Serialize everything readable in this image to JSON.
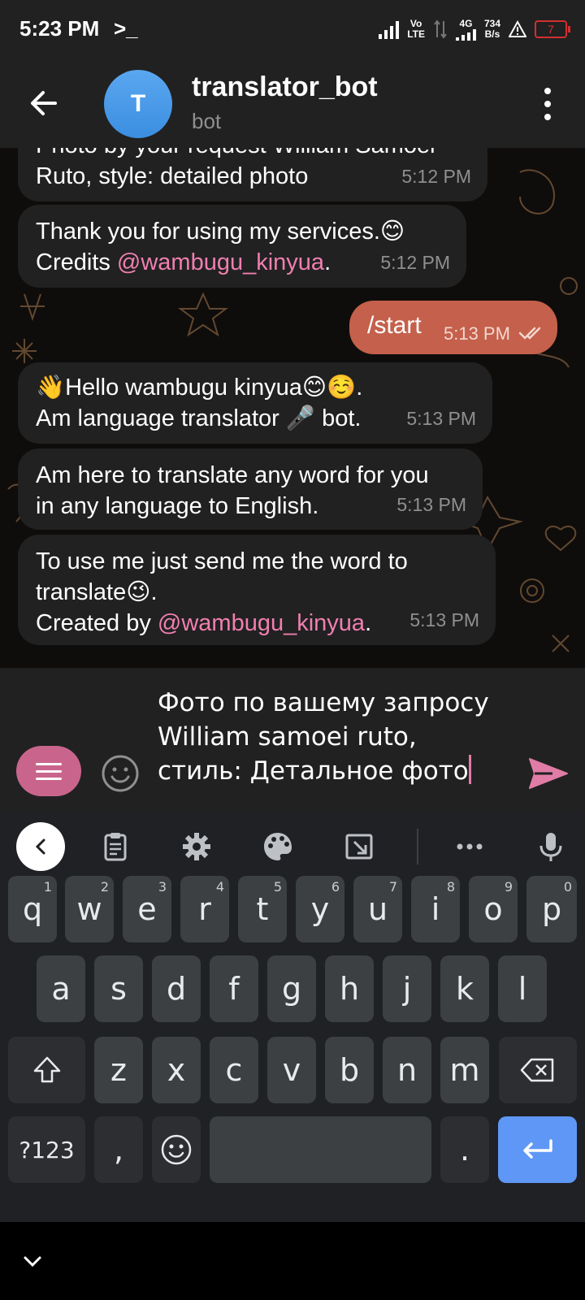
{
  "status": {
    "time": "5:23 PM",
    "prompt_icon": "terminal-prompt-icon",
    "network_label_top": "Vo",
    "network_label_bottom": "LTE",
    "data_gen": "4G",
    "speed_value": "734",
    "speed_unit": "B/s",
    "battery": "7"
  },
  "header": {
    "avatar_letter": "T",
    "title": "translator_bot",
    "subtitle": "bot"
  },
  "messages": [
    {
      "text": "Photo by your request William Samoei\nRuto, style: detailed photo",
      "time": "5:12 PM"
    },
    {
      "text_before": "Thank you for using my services.😊\nCredits ",
      "mention": "@wambugu_kinyua",
      "text_after": ".",
      "time": "5:12 PM"
    },
    {
      "text": "/start",
      "time": "5:13 PM",
      "outgoing": true
    },
    {
      "text": "👋Hello wambugu kinyua😊☺️.\n Am language translator 🎤 bot.",
      "time": "5:13 PM"
    },
    {
      "text": "Am here to translate any word for you\nin any language to English.",
      "time": "5:13 PM"
    },
    {
      "text_before": "To use me just send me the word to\ntranslate😉.\nCreated by  ",
      "mention": "@wambugu_kinyua",
      "text_after": ".",
      "time": "5:13 PM"
    }
  ],
  "composer": {
    "input_value": "Фото по вашему запросу\nWilliam samoei ruto,\nстиль: Детальное фото"
  },
  "keyboard": {
    "row1": [
      {
        "key": "q",
        "hint": "1"
      },
      {
        "key": "w",
        "hint": "2"
      },
      {
        "key": "e",
        "hint": "3"
      },
      {
        "key": "r",
        "hint": "4"
      },
      {
        "key": "t",
        "hint": "5"
      },
      {
        "key": "y",
        "hint": "6"
      },
      {
        "key": "u",
        "hint": "7"
      },
      {
        "key": "i",
        "hint": "8"
      },
      {
        "key": "o",
        "hint": "9"
      },
      {
        "key": "p",
        "hint": "0"
      }
    ],
    "row2": [
      "a",
      "s",
      "d",
      "f",
      "g",
      "h",
      "j",
      "k",
      "l"
    ],
    "row3": [
      "z",
      "x",
      "c",
      "v",
      "b",
      "n",
      "m"
    ],
    "symbols_label": "?123",
    "comma_label": ",",
    "period_label": "."
  },
  "colors": {
    "accent_pink": "#f07fb0",
    "outgoing_bubble": "#c4604b",
    "menu_button": "#c9658c",
    "enter_key": "#5e97f6",
    "avatar": "#4a9be8"
  }
}
